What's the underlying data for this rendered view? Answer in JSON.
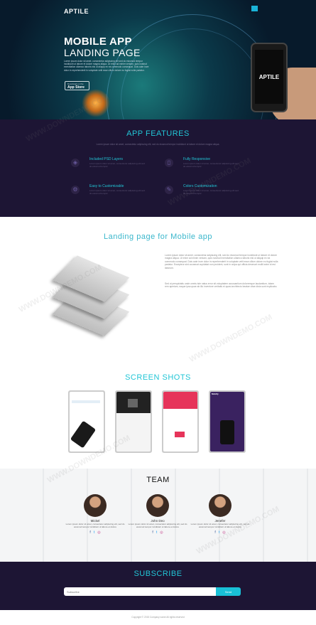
{
  "header": {
    "brand": "APTILE",
    "menu_icon": "hamburger-icon"
  },
  "hero": {
    "title": "MOBILE APP",
    "subtitle": "LANDING PAGE",
    "text": "Lorem ipsum dolor sit amet, consectetur adipiscing elit sed do eiusmod tempor incididunt ut labore et dolore magna aliqua. Ut enim ad minim veniam, quis nostrud exercitation ullamco laboris nisi ut aliquip ex ea commodo consequat. Duis aute irure dolor in reprehenderit in voluptate velit esse cillum dolore eu fugiat nulla pariatur.",
    "appstore_small": "Download on the",
    "appstore_big": "App Store",
    "phone_label": "APTILE"
  },
  "features": {
    "title": "APP FEATURES",
    "description": "Lorem ipsum dolor sit amet, consectetur adipiscing elit, sed do eiusmod tempor incididunt ut labore et dolore magna aliqua.",
    "items": [
      {
        "title": "Included PSD Layers",
        "icon": "layers-icon",
        "text": "Lorem ipsum dolor sit amet, consectetur adipiscing elit sed do eiusmod tempor."
      },
      {
        "title": "Fully Responsive",
        "icon": "mobile-icon",
        "text": "Lorem ipsum dolor sit amet, consectetur adipiscing elit sed do eiusmod tempor."
      },
      {
        "title": "Easy to Customizable",
        "icon": "gear-icon",
        "text": "Lorem ipsum dolor sit amet, consectetur adipiscing elit sed do eiusmod tempor."
      },
      {
        "title": "Colors Customization",
        "icon": "brush-icon",
        "text": "Lorem ipsum dolor sit amet, consectetur adipiscing elit sed do eiusmod tempor."
      }
    ]
  },
  "landing": {
    "title": "Landing page for Mobile app",
    "para1": "Lorem ipsum dolor sit amet, consectetur adipiscing elit, sed do eiusmod tempor incididunt ut labore et dolore magna aliqua. Ut enim ad minim veniam, quis nostrud exercitation ullamco laboris nisi ut aliquip ex ea commodo consequat. Duis aute irure dolor in reprehenderit in voluptate velit esse cillum dolore eu fugiat nulla pariatur. Excepteur sint occaecat cupidatat non proident, sunt in culpa qui officia deserunt mollit anim id est laborum.",
    "para2": "Sed ut perspiciatis unde omnis iste natus error sit voluptatem accusantium doloremque laudantium, totam rem aperiam, eaque ipsa quae ab illo inventore veritatis et quasi architecto beatae vitae dicta sunt explicabo."
  },
  "screenshots": {
    "title": "SCREEN SHOTS",
    "shot4_label": "Mobify"
  },
  "team": {
    "title": "TEAM",
    "members": [
      {
        "name": "Mickel",
        "text": "Lorem ipsum dolor sit amet, consectetur adipiscing elit, sed do eiusmod tempor incididunt ut labore et dolore"
      },
      {
        "name": "John Deo",
        "text": "Lorem ipsum dolor sit amet, consectetur adipiscing elit, sed do eiusmod tempor incididunt ut labore et dolore"
      },
      {
        "name": "Jenefer",
        "text": "Lorem ipsum dolor sit amet, consectetur adipiscing elit, sed do eiusmod tempor incididunt ut labore et dolore"
      }
    ],
    "social": [
      "f",
      "t",
      "◎"
    ]
  },
  "subscribe": {
    "title": "SUBSCRIBE",
    "placeholder": "Subscribe",
    "button": "Send"
  },
  "footer": {
    "text": "Copyright © 2015 Company name All rights reserved"
  },
  "watermark": "WWW.DOWNDEMO.COM",
  "colors": {
    "accent": "#22c6d6",
    "dark": "#1d1534"
  }
}
